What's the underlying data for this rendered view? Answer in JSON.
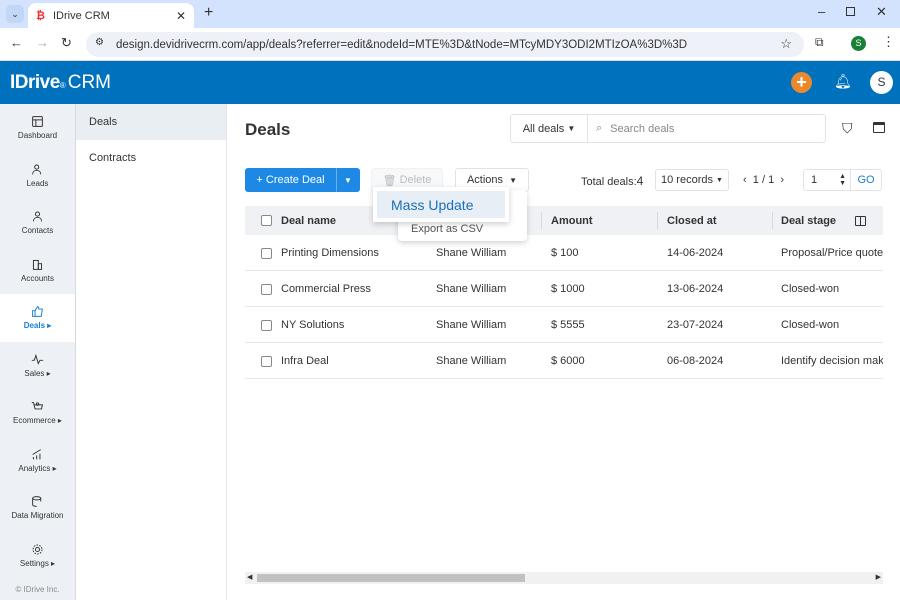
{
  "browser": {
    "tab_title": "IDrive CRM",
    "url": "design.devidrivecrm.com/app/deals?referrer=edit&nodeId=MTE%3D&tNode=MTcyMDY3ODI2MTIzOA%3D%3D",
    "profile": "S"
  },
  "header": {
    "logo": "IDrive CRM",
    "logo_main": "IDrive",
    "logo_suffix": "CRM",
    "avatar": "S",
    "brand_color": "#0071bc",
    "accent_color": "#e8892d"
  },
  "nav": {
    "items": [
      {
        "label": "Dashboard",
        "icon": "dashboard-icon"
      },
      {
        "label": "Leads",
        "icon": "leads-icon"
      },
      {
        "label": "Contacts",
        "icon": "contacts-icon"
      },
      {
        "label": "Accounts",
        "icon": "accounts-icon"
      },
      {
        "label": "Deals ▸",
        "icon": "thumbs-up-icon",
        "active": true
      },
      {
        "label": "Sales ▸",
        "icon": "pulse-icon"
      },
      {
        "label": "Ecommerce ▸",
        "icon": "cart-icon"
      },
      {
        "label": "Analytics ▸",
        "icon": "chart-icon"
      },
      {
        "label": "Data Migration",
        "icon": "database-icon"
      },
      {
        "label": "Settings ▸",
        "icon": "gear-icon"
      }
    ],
    "copyright": "© IDrive Inc."
  },
  "subnav": {
    "items": [
      {
        "label": "Deals"
      },
      {
        "label": "Contracts"
      }
    ]
  },
  "main": {
    "title": "Deals",
    "filter_select": "All deals",
    "search_placeholder": "Search deals",
    "create_label": "+ Create Deal",
    "delete_label": "Delete",
    "actions_label": "Actions",
    "total_label": "Total deals:",
    "total_value": "4",
    "records_select": "10 records",
    "pager": "1 / 1",
    "page_input": "1",
    "go_label": "GO",
    "actions_menu": {
      "items": [
        "Mass Update",
        "Export as CSV"
      ]
    },
    "columns": [
      "Deal name",
      "",
      "Amount",
      "Closed at",
      "Deal stage"
    ],
    "rows": [
      {
        "name": "Printing Dimensions",
        "owner": "Shane William",
        "amount": "$ 100",
        "closed": "14-06-2024",
        "stage": "Proposal/Price quote"
      },
      {
        "name": "Commercial Press",
        "owner": "Shane William",
        "amount": "$ 1000",
        "closed": "13-06-2024",
        "stage": "Closed-won"
      },
      {
        "name": "NY Solutions",
        "owner": "Shane William",
        "amount": "$ 5555",
        "closed": "23-07-2024",
        "stage": "Closed-won"
      },
      {
        "name": "Infra Deal",
        "owner": "Shane William",
        "amount": "$ 6000",
        "closed": "06-08-2024",
        "stage": "Identify decision makers"
      }
    ]
  }
}
